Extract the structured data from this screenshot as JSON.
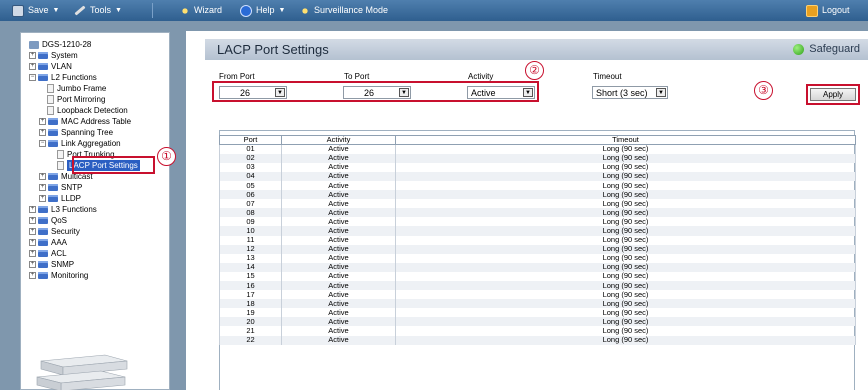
{
  "toolbar": {
    "save": "Save",
    "tools": "Tools",
    "wizard": "Wizard",
    "help": "Help",
    "surveillance": "Surveillance Mode",
    "logout": "Logout"
  },
  "tree": {
    "root": "DGS-1210-28",
    "items": [
      "System",
      "VLAN",
      "L2 Functions",
      "Jumbo Frame",
      "Port Mirroring",
      "Loopback Detection",
      "MAC Address Table",
      "Spanning Tree",
      "Link Aggregation",
      "Port Trunking",
      "LACP Port Settings",
      "Multicast",
      "SNTP",
      "LLDP",
      "L3 Functions",
      "QoS",
      "Security",
      "AAA",
      "ACL",
      "SNMP",
      "Monitoring"
    ]
  },
  "page": {
    "title": "LACP Port Settings",
    "safeguard": "Safeguard"
  },
  "form": {
    "from_port_label": "From Port",
    "from_port_value": "26",
    "to_port_label": "To Port",
    "to_port_value": "26",
    "activity_label": "Activity",
    "activity_value": "Active",
    "timeout_label": "Timeout",
    "timeout_value": "Short (3 sec)",
    "apply": "Apply"
  },
  "markers": [
    "①",
    "②",
    "③"
  ],
  "table": {
    "headers": [
      "Port",
      "Activity",
      "Timeout"
    ],
    "rows": [
      [
        "01",
        "Active",
        "Long (90 sec)"
      ],
      [
        "02",
        "Active",
        "Long (90 sec)"
      ],
      [
        "03",
        "Active",
        "Long (90 sec)"
      ],
      [
        "04",
        "Active",
        "Long (90 sec)"
      ],
      [
        "05",
        "Active",
        "Long (90 sec)"
      ],
      [
        "06",
        "Active",
        "Long (90 sec)"
      ],
      [
        "07",
        "Active",
        "Long (90 sec)"
      ],
      [
        "08",
        "Active",
        "Long (90 sec)"
      ],
      [
        "09",
        "Active",
        "Long (90 sec)"
      ],
      [
        "10",
        "Active",
        "Long (90 sec)"
      ],
      [
        "11",
        "Active",
        "Long (90 sec)"
      ],
      [
        "12",
        "Active",
        "Long (90 sec)"
      ],
      [
        "13",
        "Active",
        "Long (90 sec)"
      ],
      [
        "14",
        "Active",
        "Long (90 sec)"
      ],
      [
        "15",
        "Active",
        "Long (90 sec)"
      ],
      [
        "16",
        "Active",
        "Long (90 sec)"
      ],
      [
        "17",
        "Active",
        "Long (90 sec)"
      ],
      [
        "18",
        "Active",
        "Long (90 sec)"
      ],
      [
        "19",
        "Active",
        "Long (90 sec)"
      ],
      [
        "20",
        "Active",
        "Long (90 sec)"
      ],
      [
        "21",
        "Active",
        "Long (90 sec)"
      ],
      [
        "22",
        "Active",
        "Long (90 sec)"
      ]
    ]
  }
}
